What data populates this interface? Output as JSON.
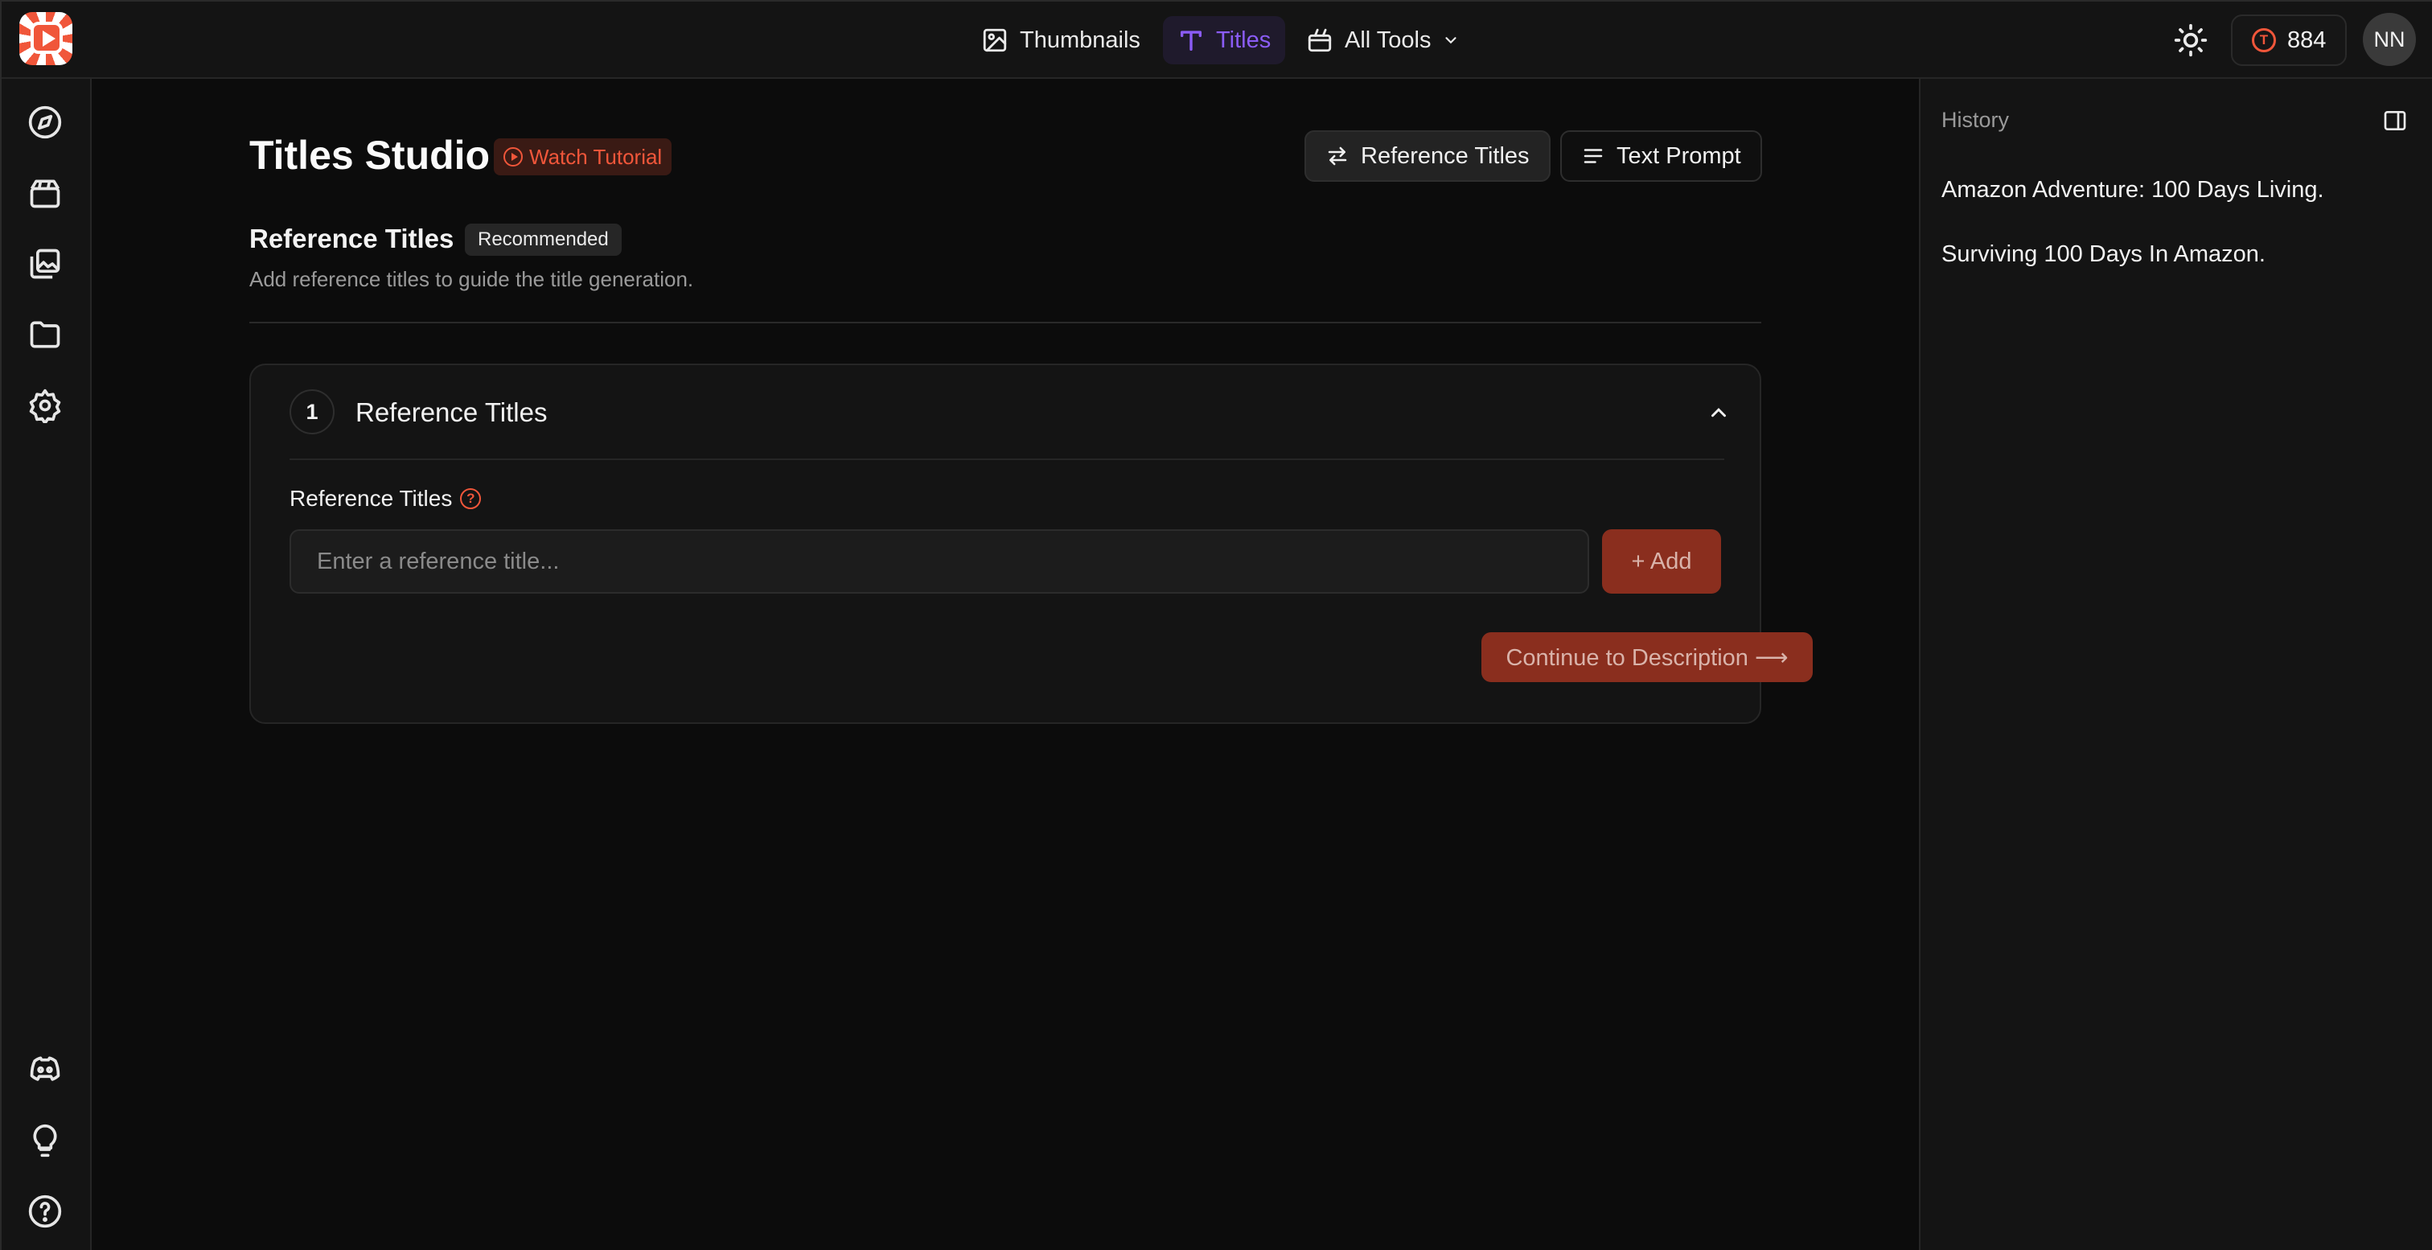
{
  "nav": {
    "thumbnails": "Thumbnails",
    "titles": "Titles",
    "all_tools": "All Tools"
  },
  "credits": {
    "badge": "T",
    "count": "884"
  },
  "user": {
    "initials": "NN"
  },
  "page": {
    "title": "Titles Studio",
    "tutorial": "Watch Tutorial",
    "mode_reference": "Reference Titles",
    "mode_text": "Text Prompt"
  },
  "section": {
    "title": "Reference Titles",
    "badge": "Recommended",
    "description": "Add reference titles to guide the title generation."
  },
  "card": {
    "step": "1",
    "title": "Reference Titles",
    "field_label": "Reference Titles",
    "input_placeholder": "Enter a reference title...",
    "input_value": "",
    "add_label": "+ Add",
    "continue_label": "Continue to Description ⟶"
  },
  "history": {
    "title": "History",
    "items": [
      "Amazon Adventure: 100 Days Living.",
      "Surviving 100 Days In Amazon."
    ]
  },
  "colors": {
    "accent": "#f0563a",
    "titles_accent": "#8b5cf6",
    "button_disabled": "#8a2e1e"
  },
  "icons": {
    "sidebar_top": [
      "compass-icon",
      "video-clapper-icon",
      "image-gallery-icon",
      "folder-icon",
      "settings-icon"
    ],
    "sidebar_bottom": [
      "discord-icon",
      "lightbulb-icon",
      "help-icon"
    ]
  }
}
